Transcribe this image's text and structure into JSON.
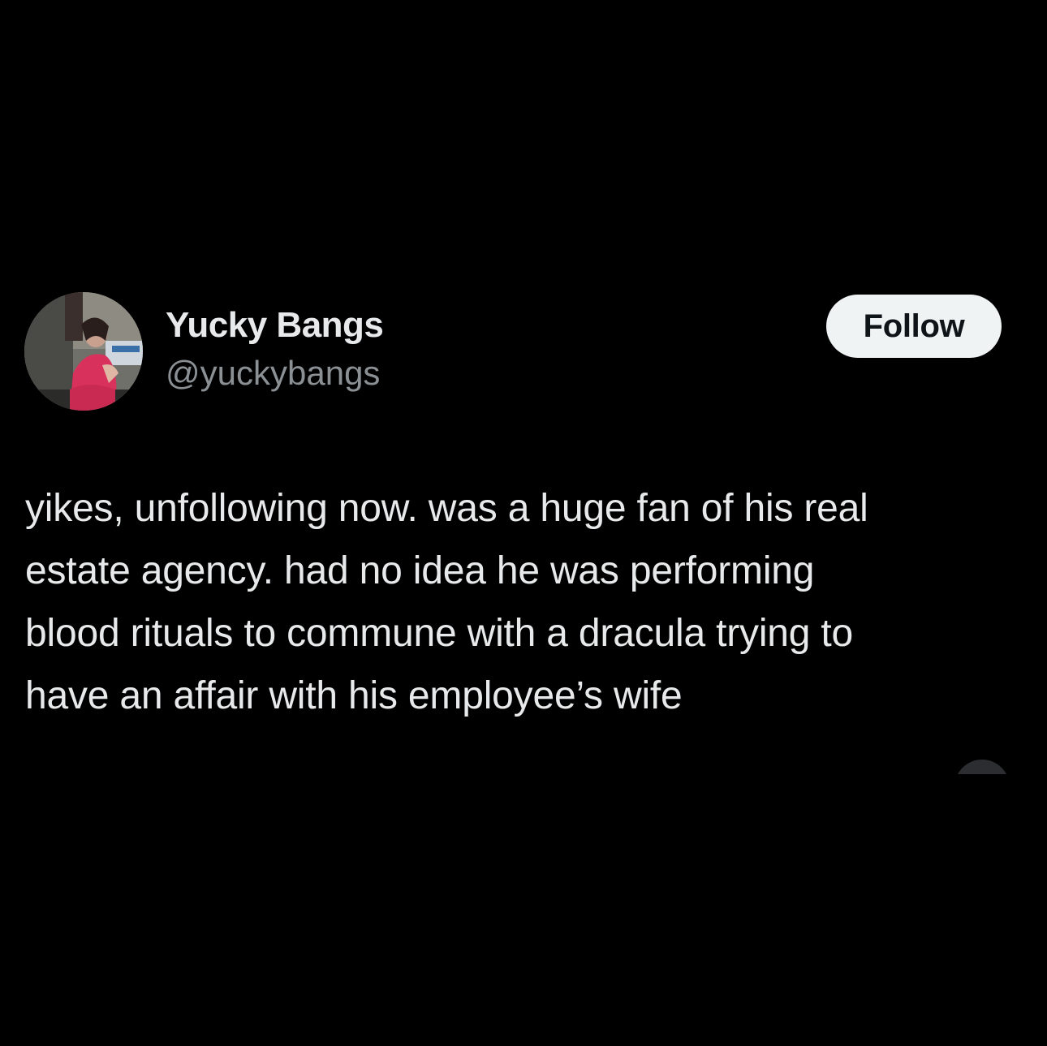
{
  "tweet": {
    "author": {
      "display_name": "Yucky Bangs",
      "handle": "@yuckybangs",
      "avatar_icon": "profile-photo-avatar"
    },
    "follow_label": "Follow",
    "text_lines": [
      "yikes, unfollowing now. was a huge fan of his real",
      "estate agency. had no idea he was performing",
      "blood rituals to commune with a dracula trying to",
      "have an affair with his employee’s wife"
    ]
  },
  "colors": {
    "background": "#000000",
    "primary_text": "#e7e9ea",
    "secondary_text": "#8b9095",
    "follow_button_bg": "#eff3f4",
    "follow_button_text": "#0f1419"
  }
}
